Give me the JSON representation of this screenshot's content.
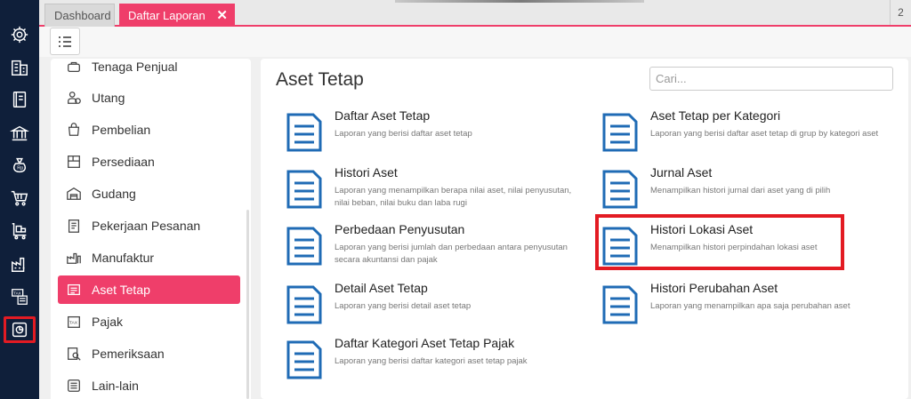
{
  "tabs": [
    {
      "label": "Dashboard"
    },
    {
      "label": "Daftar Laporan",
      "close": "✕"
    }
  ],
  "tab_count": "2",
  "rail": {
    "icons": [
      "gear-icon",
      "building-icon",
      "book-icon",
      "bank-icon",
      "money-bag-icon",
      "cart-icon",
      "cart-box-icon",
      "factory-icon",
      "tax-icon",
      "report-chart-icon"
    ],
    "active_index": 9,
    "active_color": "#e31b23"
  },
  "menu": {
    "items": [
      {
        "label": "Tenaga Penjual",
        "icon": "salesperson-icon"
      },
      {
        "label": "Utang",
        "icon": "debt-icon"
      },
      {
        "label": "Pembelian",
        "icon": "purchase-bag-icon"
      },
      {
        "label": "Persediaan",
        "icon": "inventory-icon"
      },
      {
        "label": "Gudang",
        "icon": "warehouse-icon"
      },
      {
        "label": "Pekerjaan Pesanan",
        "icon": "job-order-icon"
      },
      {
        "label": "Manufaktur",
        "icon": "manufacture-icon"
      },
      {
        "label": "Aset Tetap",
        "icon": "fixed-asset-icon"
      },
      {
        "label": "Pajak",
        "icon": "tax-icon"
      },
      {
        "label": "Pemeriksaan",
        "icon": "audit-icon"
      },
      {
        "label": "Lain-lain",
        "icon": "list-icon"
      }
    ],
    "active_index": 7
  },
  "content": {
    "title": "Aset Tetap",
    "search_placeholder": "Cari...",
    "reports_left": [
      {
        "title": "Daftar Aset Tetap",
        "desc": "Laporan yang berisi daftar aset tetap"
      },
      {
        "title": "Histori Aset",
        "desc": "Laporan yang menampilkan berapa nilai aset, nilai penyusutan, nilai beban, nilai buku dan laba rugi"
      },
      {
        "title": "Perbedaan Penyusutan",
        "desc": "Laporan yang berisi jumlah dan perbedaan antara penyusutan secara akuntansi dan pajak"
      },
      {
        "title": "Detail Aset Tetap",
        "desc": "Laporan yang berisi detail aset tetap"
      },
      {
        "title": "Daftar Kategori Aset Tetap Pajak",
        "desc": "Laporan yang berisi daftar kategori aset tetap pajak"
      }
    ],
    "reports_right": [
      {
        "title": "Aset Tetap per Kategori",
        "desc": "Laporan yang berisi daftar aset tetap di grup by kategori aset"
      },
      {
        "title": "Jurnal Aset",
        "desc": "Menampilkan histori jurnal dari aset yang di pilih"
      },
      {
        "title": "Histori Lokasi Aset",
        "desc": "Menampilkan histori perpindahan lokasi aset",
        "highlighted": true
      },
      {
        "title": "Histori Perubahan Aset",
        "desc": "Laporan yang menampilkan apa saja perubahan aset"
      }
    ]
  },
  "colors": {
    "accent": "#ef3e6a",
    "rail_bg": "#0f1f3a",
    "doc_icon": "#1f6bb5",
    "highlight": "#e31b23"
  }
}
